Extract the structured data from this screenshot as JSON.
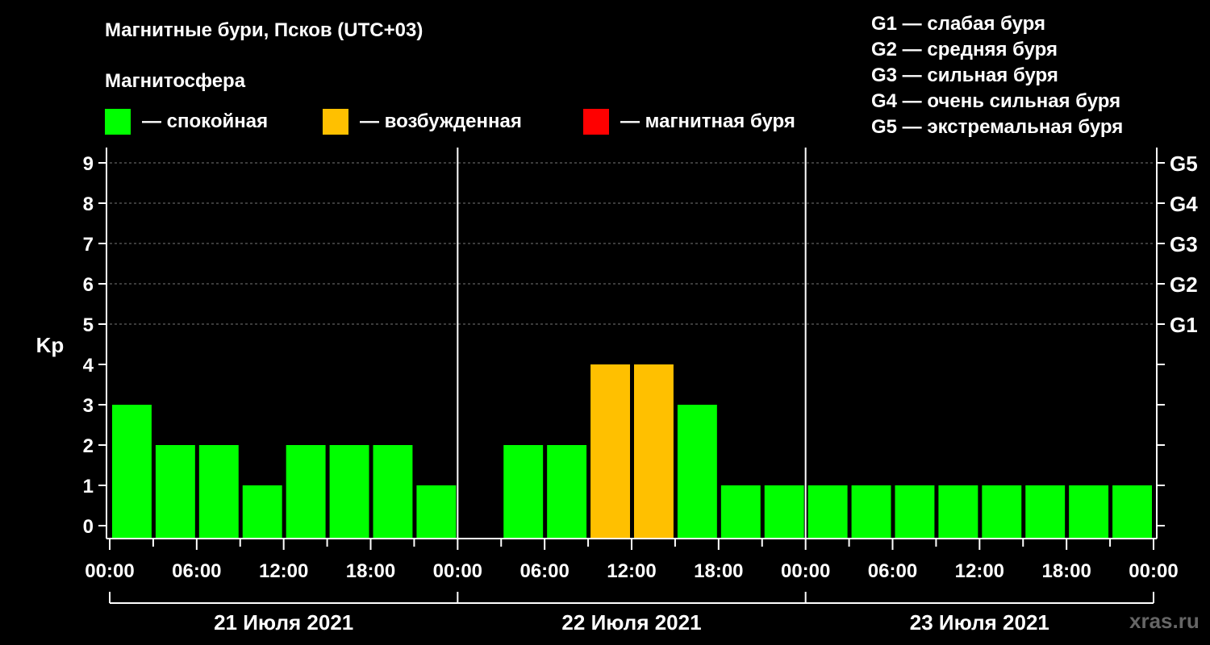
{
  "title": "Магнитные бури, Псков (UTC+03)",
  "subtitle": "Магнитосфера",
  "legend": [
    {
      "label": "— спокойная",
      "color": "#00ff00"
    },
    {
      "label": "— возбужденная",
      "color": "#ffc000"
    },
    {
      "label": "— магнитная буря",
      "color": "#ff0000"
    }
  ],
  "g_legend": [
    "G1 — слабая буря",
    "G2 — средняя буря",
    "G3 — сильная буря",
    "G4 — очень сильная буря",
    "G5 — экстремальная буря"
  ],
  "watermark": "xras.ru",
  "chart_data": {
    "type": "bar",
    "ylabel": "Kp",
    "ylim": [
      0,
      9
    ],
    "y_ticks": [
      0,
      1,
      2,
      3,
      4,
      5,
      6,
      7,
      8,
      9
    ],
    "right_labels": [
      {
        "value": 5,
        "label": "G1"
      },
      {
        "value": 6,
        "label": "G2"
      },
      {
        "value": 7,
        "label": "G3"
      },
      {
        "value": 8,
        "label": "G4"
      },
      {
        "value": 9,
        "label": "G5"
      }
    ],
    "x_tick_labels": [
      "00:00",
      "06:00",
      "12:00",
      "18:00",
      "00:00",
      "06:00",
      "12:00",
      "18:00",
      "00:00",
      "06:00",
      "12:00",
      "18:00",
      "00:00"
    ],
    "days": [
      "21 Июля 2021",
      "22 Июля 2021",
      "23 Июля 2021"
    ],
    "interval_hours": 3,
    "values": [
      3,
      2,
      2,
      1,
      2,
      2,
      2,
      1,
      null,
      2,
      2,
      4,
      4,
      3,
      1,
      1,
      1,
      1,
      1,
      1,
      1,
      1,
      1,
      1
    ],
    "colors": {
      "quiet": "#00ff00",
      "unsettled": "#ffc000",
      "storm": "#ff0000"
    },
    "grid": "dashed at Kp 5–9"
  }
}
